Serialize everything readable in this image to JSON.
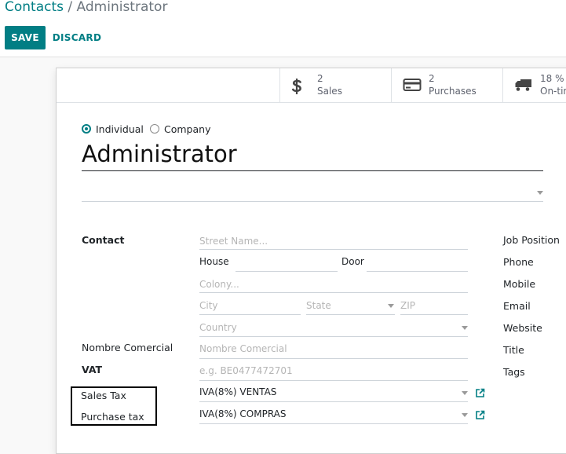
{
  "breadcrumb": {
    "parent": "Contacts",
    "separator": "/",
    "current": "Administrator"
  },
  "toolbar": {
    "save_label": "SAVE",
    "discard_label": "DISCARD"
  },
  "stats": [
    {
      "value": "2",
      "label": "Sales",
      "icon": "dollar-icon"
    },
    {
      "value": "2",
      "label": "Purchases",
      "icon": "credit-card-icon"
    },
    {
      "value": "18 %",
      "label": "On-tin",
      "icon": "truck-icon"
    }
  ],
  "company_type": {
    "individual_label": "Individual",
    "company_label": "Company",
    "selected": "Individual"
  },
  "partner_name": "Administrator",
  "address": {
    "label": "Contact",
    "street_placeholder": "Street Name...",
    "house_label": "House",
    "door_label": "Door",
    "colony_placeholder": "Colony...",
    "city_placeholder": "City",
    "state_placeholder": "State",
    "zip_placeholder": "ZIP",
    "country_placeholder": "Country"
  },
  "commercial_name": {
    "label": "Nombre Comercial",
    "placeholder": "Nombre Comercial"
  },
  "vat": {
    "label": "VAT",
    "placeholder": "e.g. BE0477472701"
  },
  "sales_tax": {
    "label": "Sales Tax",
    "value": "IVA(8%) VENTAS"
  },
  "purchase_tax": {
    "label": "Purchase tax",
    "value": "IVA(8%) COMPRAS"
  },
  "right_labels": [
    "Job Position",
    "Phone",
    "Mobile",
    "Email",
    "Website",
    "Title",
    "Tags"
  ],
  "colors": {
    "accent": "#017e84",
    "annotation_box": "#000000"
  }
}
